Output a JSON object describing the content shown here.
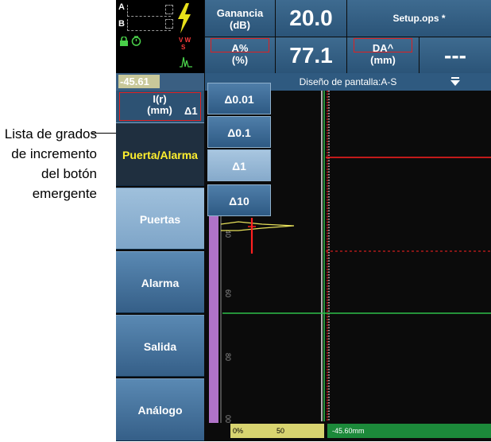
{
  "callout": {
    "lines": [
      "Lista de grados",
      "de incremento",
      "del botón",
      "emergente"
    ]
  },
  "status": {
    "gate_a": "A",
    "gate_b": "B",
    "flags_top": "V W",
    "flags_bottom": "S"
  },
  "header": {
    "gain_label_line1": "Ganancia",
    "gain_label_line2": "(dB)",
    "gain_value": "20.0",
    "setup_file": "Setup.ops *",
    "reading1_label_line1": "A%",
    "reading1_label_line2": "(%)",
    "reading1_value": "77.1",
    "reading2_label_line1": "DA^",
    "reading2_label_line2": "(mm)",
    "reading2_value": "---"
  },
  "param_strip": {
    "value": "-45.61",
    "param_line1": "I(r)",
    "param_line2": "(mm)",
    "param_increment": "Δ1"
  },
  "layout_bar": {
    "label": "Diseño de pantalla:A-S"
  },
  "menu": {
    "group_label": "Puerta/Alarma",
    "items": [
      "Puertas",
      "Alarma",
      "Salida",
      "Análogo"
    ]
  },
  "increments": {
    "items": [
      "Δ0.01",
      "Δ0.1",
      "Δ1",
      "Δ10"
    ],
    "selected": "Δ1"
  },
  "scan": {
    "ticks": [
      "40",
      "60",
      "80",
      "00"
    ],
    "bottom_left": "0%",
    "bottom_mid": "50",
    "bottom_right": "-45.60mm"
  },
  "colors": {
    "accent": "#2b5478",
    "gate_red": "#ff2020",
    "gate_green": "#2ec04a",
    "group_text": "#ffef2e"
  }
}
